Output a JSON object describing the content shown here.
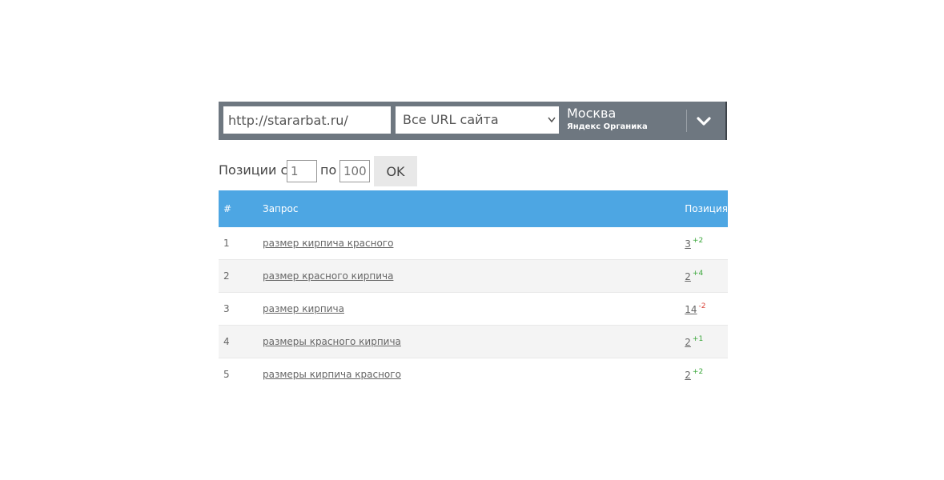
{
  "filter": {
    "url_value": "http://stararbat.ru/",
    "url_scope_selected": "Все URL сайта",
    "region_city": "Москва",
    "region_engine": "Яндекс Органика"
  },
  "range": {
    "label_from": "Позиции с",
    "from_placeholder": "1",
    "label_to": "по",
    "to_placeholder": "100",
    "ok_label": "OK"
  },
  "table": {
    "headers": {
      "num": "#",
      "query": "Запрос",
      "position": "Позиция"
    },
    "rows": [
      {
        "num": "1",
        "query": "размер кирпича красного",
        "position": "3",
        "delta": "+2",
        "trend": "up"
      },
      {
        "num": "2",
        "query": "размер красного кирпича",
        "position": "2",
        "delta": "+4",
        "trend": "up"
      },
      {
        "num": "3",
        "query": "размер кирпича",
        "position": "14",
        "delta": "-2",
        "trend": "down"
      },
      {
        "num": "4",
        "query": "размеры красного кирпича",
        "position": "2",
        "delta": "+1",
        "trend": "up"
      },
      {
        "num": "5",
        "query": "размеры кирпича красного",
        "position": "2",
        "delta": "+2",
        "trend": "up"
      }
    ]
  },
  "colors": {
    "bar": "#6e7780",
    "header": "#4da6e3",
    "up": "#3aa63a",
    "down": "#d9443a"
  },
  "icons": {
    "select_arrow": "chevron-down-icon",
    "expand": "chevron-down-icon"
  }
}
